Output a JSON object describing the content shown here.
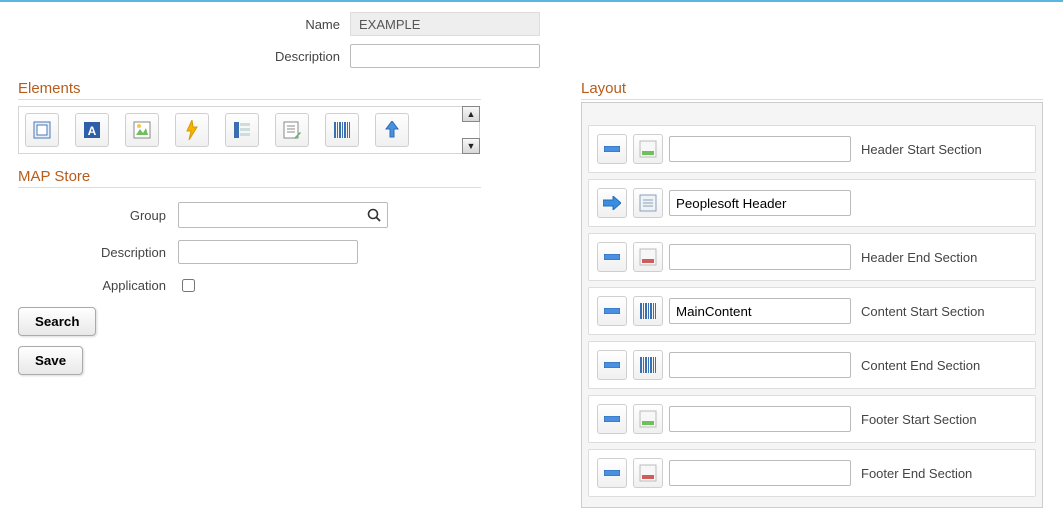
{
  "form": {
    "name_label": "Name",
    "name_value": "EXAMPLE",
    "description_label": "Description",
    "description_value": ""
  },
  "elements": {
    "heading": "Elements",
    "items": [
      {
        "name": "container-element-icon"
      },
      {
        "name": "text-element-icon"
      },
      {
        "name": "image-element-icon"
      },
      {
        "name": "action-element-icon"
      },
      {
        "name": "list-element-icon"
      },
      {
        "name": "edit-element-icon"
      },
      {
        "name": "barcode-element-icon"
      },
      {
        "name": "upload-element-icon"
      }
    ]
  },
  "map_store": {
    "heading": "MAP Store",
    "group_label": "Group",
    "group_value": "",
    "description_label": "Description",
    "description_value": "",
    "application_label": "Application",
    "application_checked": false,
    "search_label": "Search",
    "save_label": "Save"
  },
  "layout": {
    "heading": "Layout",
    "items": [
      {
        "value": "",
        "label": "Header Start Section",
        "row_icon": "header-start",
        "arrow": "minus"
      },
      {
        "value": "Peoplesoft Header",
        "label": "",
        "row_icon": "header-item",
        "arrow": "right"
      },
      {
        "value": "",
        "label": "Header End Section",
        "row_icon": "header-end",
        "arrow": "minus"
      },
      {
        "value": "MainContent",
        "label": "Content Start Section",
        "row_icon": "content-start",
        "arrow": "minus"
      },
      {
        "value": "",
        "label": "Content End Section",
        "row_icon": "content-end",
        "arrow": "minus"
      },
      {
        "value": "",
        "label": "Footer Start Section",
        "row_icon": "footer-start",
        "arrow": "minus"
      },
      {
        "value": "",
        "label": "Footer End Section",
        "row_icon": "footer-end",
        "arrow": "minus"
      }
    ]
  }
}
